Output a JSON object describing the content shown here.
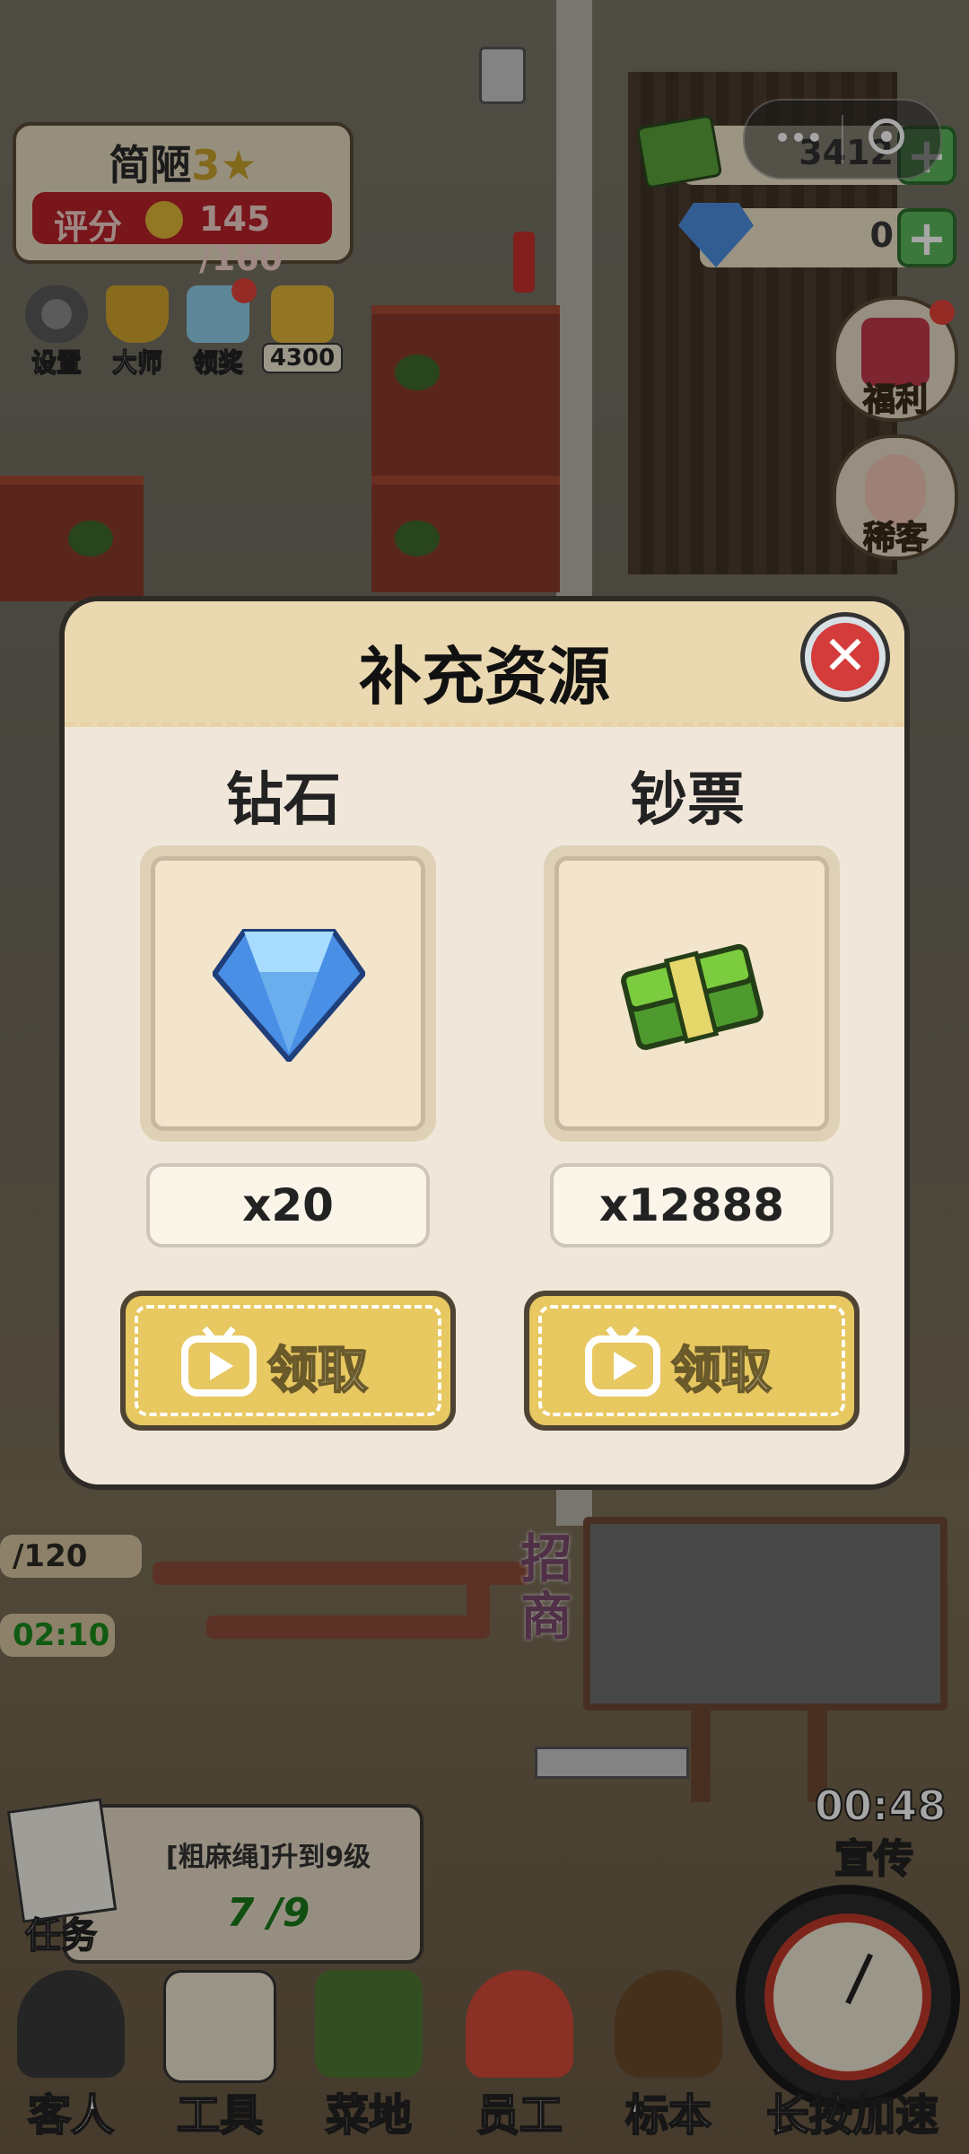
{
  "header": {
    "level_title": "简陋",
    "level_stars": "3★",
    "score_label": "评分",
    "score_value": "145 /160",
    "buttons": [
      {
        "label": "设置",
        "icon": "gear-icon"
      },
      {
        "label": "大师",
        "icon": "trophy-icon"
      },
      {
        "label": "领奖",
        "icon": "gift-box-icon",
        "badge": true
      },
      {
        "label": "4300",
        "icon": "podium-icon"
      }
    ]
  },
  "resources": {
    "cash": "3412",
    "diamond": "0"
  },
  "side_buttons": [
    {
      "label": "福利",
      "icon": "bag-icon",
      "badge": true
    },
    {
      "label": "稀客",
      "icon": "cat-lady-icon"
    }
  ],
  "scene": {
    "left_values": [
      "/120",
      "02:10"
    ],
    "sign": "招商"
  },
  "task": {
    "label": "任务",
    "text": "[粗麻绳]升到9级",
    "progress": "7 /9"
  },
  "promo": {
    "timer": "00:48",
    "label": "宣传"
  },
  "bottom_nav": [
    {
      "label": "客人",
      "icon": "customer-icon"
    },
    {
      "label": "工具",
      "icon": "tools-icon"
    },
    {
      "label": "菜地",
      "icon": "vegetable-icon"
    },
    {
      "label": "员工",
      "icon": "staff-icon"
    },
    {
      "label": "标本",
      "icon": "poop-icon"
    },
    {
      "label": "长按加速",
      "icon": "clock-icon"
    }
  ],
  "dialog": {
    "title": "补充资源",
    "close_icon": "close-icon",
    "items": [
      {
        "name": "钻石",
        "icon": "diamond-icon",
        "amount": "x20",
        "button": "领取",
        "button_icon": "video-play-icon"
      },
      {
        "name": "钞票",
        "icon": "cash-stack-icon",
        "amount": "x12888",
        "button": "领取",
        "button_icon": "video-play-icon"
      }
    ]
  },
  "colors": {
    "dialog_bg": "#f0e7da",
    "dialog_header": "#ead8b0",
    "claim_button": "#e7c861",
    "close_button": "#d43c3c",
    "score_bar": "#b8232a"
  }
}
